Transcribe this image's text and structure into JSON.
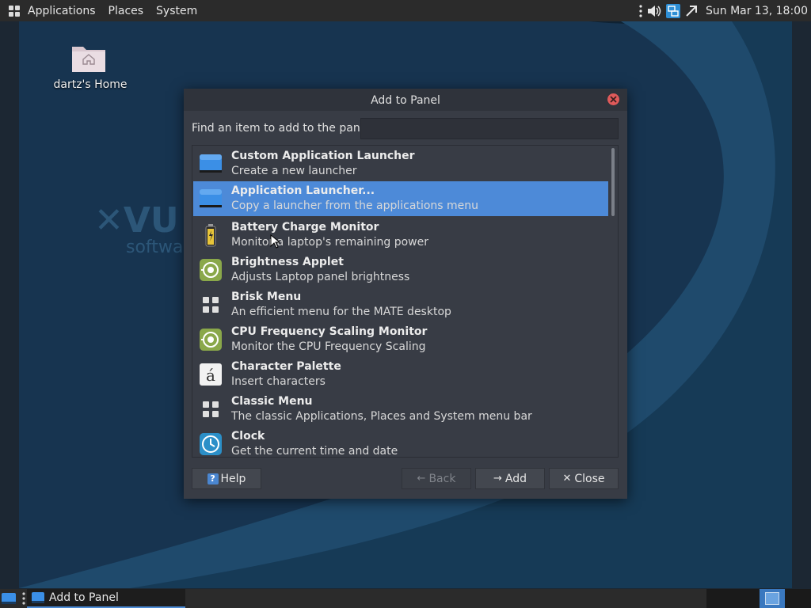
{
  "top_panel": {
    "menus": [
      "Applications",
      "Places",
      "System"
    ],
    "tray_icons": [
      "more-vertical-icon",
      "volume-icon",
      "network-icon",
      "bluetooth-icon"
    ],
    "clock": "Sun Mar 13, 18:00"
  },
  "desktop": {
    "home_label": "dartz's Home",
    "accent_color": "#1e3f5c"
  },
  "dialog": {
    "title": "Add to Panel",
    "find_label": "Find an item to add to the panel:",
    "search_value": "",
    "selected_color": "#4d8ad8",
    "items": [
      {
        "name": "Custom Application Launcher",
        "desc": "Create a new launcher",
        "icon": "launcher-icon"
      },
      {
        "name": "Application Launcher...",
        "desc": "Copy a launcher from the applications menu",
        "icon": "launcher-icon"
      },
      {
        "name": "Battery Charge Monitor",
        "desc": "Monitor a laptop's remaining power",
        "icon": "battery-icon"
      },
      {
        "name": "Brightness Applet",
        "desc": "Adjusts Laptop panel brightness",
        "icon": "brightness-icon"
      },
      {
        "name": "Brisk Menu",
        "desc": "An efficient menu for the MATE desktop",
        "icon": "grid-menu-icon"
      },
      {
        "name": "CPU Frequency Scaling Monitor",
        "desc": "Monitor the CPU Frequency Scaling",
        "icon": "cpu-frequency-icon"
      },
      {
        "name": "Character Palette",
        "desc": "Insert characters",
        "icon": "character-palette-icon"
      },
      {
        "name": "Classic Menu",
        "desc": "The classic Applications, Places and System menu bar",
        "icon": "grid-menu-icon"
      },
      {
        "name": "Clock",
        "desc": "Get the current time and date",
        "icon": "clock-icon"
      }
    ],
    "buttons": {
      "help": "Help",
      "back": "Back",
      "add": "Add",
      "close": "Close"
    }
  },
  "bottom_panel": {
    "task_label": "Add to Panel"
  }
}
